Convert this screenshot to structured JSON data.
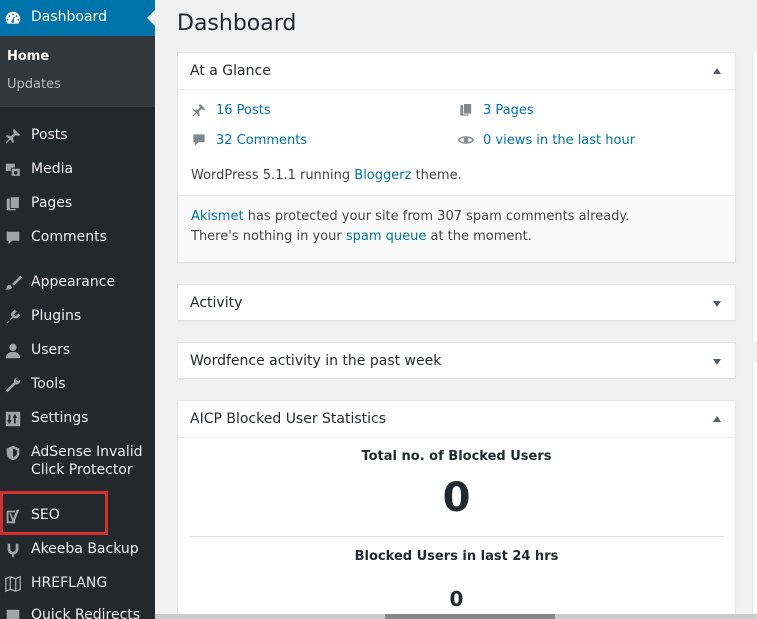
{
  "sidebar": {
    "current": {
      "label": "Dashboard",
      "icon": "dashboard-icon"
    },
    "submenu": [
      {
        "label": "Home",
        "active": true
      },
      {
        "label": "Updates",
        "active": false
      }
    ],
    "items": [
      {
        "label": "Posts",
        "icon": "pushpin-icon"
      },
      {
        "label": "Media",
        "icon": "media-icon"
      },
      {
        "label": "Pages",
        "icon": "pages-icon"
      },
      {
        "label": "Comments",
        "icon": "comment-icon"
      },
      {
        "label": "Appearance",
        "icon": "paintbrush-icon"
      },
      {
        "label": "Plugins",
        "icon": "plugin-icon"
      },
      {
        "label": "Users",
        "icon": "user-icon"
      },
      {
        "label": "Tools",
        "icon": "wrench-icon"
      },
      {
        "label": "Settings",
        "icon": "settings-icon"
      },
      {
        "label": "AdSense Invalid Click Protector",
        "icon": "shield-icon"
      },
      {
        "label": "SEO",
        "icon": "yoast-icon"
      },
      {
        "label": "Akeeba Backup",
        "icon": "akeeba-icon"
      },
      {
        "label": "HREFLANG",
        "icon": "map-icon"
      },
      {
        "label": "Quick Redirects",
        "icon": "redirect-icon"
      }
    ]
  },
  "page_title": "Dashboard",
  "at_a_glance": {
    "title": "At a Glance",
    "posts": "16 Posts",
    "pages": "3 Pages",
    "comments": "32 Comments",
    "views": "0 views in the last hour",
    "wp_prefix": "WordPress 5.1.1 running ",
    "theme": "Bloggerz",
    "wp_suffix": " theme.",
    "akismet_link": "Akismet",
    "akismet_text": " has protected your site from 307 spam comments already.",
    "spam_prefix": "There's nothing in your ",
    "spam_link": "spam queue",
    "spam_suffix": " at the moment."
  },
  "activity": {
    "title": "Activity"
  },
  "wordfence": {
    "title": "Wordfence activity in the past week"
  },
  "aicp": {
    "title": "AICP Blocked User Statistics",
    "total_label": "Total no. of Blocked Users",
    "total_value": "0",
    "day_label": "Blocked Users in last 24 hrs",
    "day_value": "0"
  },
  "colors": {
    "sidebar": "#23282d",
    "accent": "#0073aa",
    "highlight": "#d32f2f"
  }
}
